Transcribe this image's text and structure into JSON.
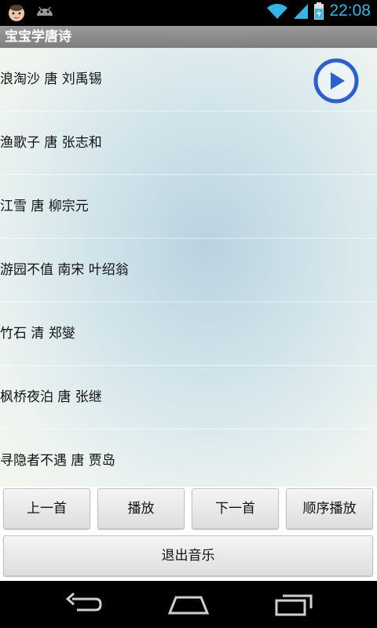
{
  "status_bar": {
    "time": "22:08",
    "icons": [
      "baby-face-icon",
      "android-icon",
      "wifi-icon",
      "signal-icon",
      "battery-icon"
    ],
    "accent_color": "#33b5e5"
  },
  "app": {
    "title": "宝宝学唐诗"
  },
  "poems": [
    {
      "label": "浪淘沙 唐 刘禹锡"
    },
    {
      "label": "渔歌子 唐 张志和"
    },
    {
      "label": "江雪 唐 柳宗元"
    },
    {
      "label": "游园不值 南宋 叶绍翁"
    },
    {
      "label": "竹石 清 郑燮"
    },
    {
      "label": "枫桥夜泊 唐 张继"
    },
    {
      "label": "寻隐者不遇 唐 贾岛"
    }
  ],
  "controls": {
    "prev_label": "上一首",
    "play_label": "播放",
    "next_label": "下一首",
    "order_label": "顺序播放",
    "exit_label": "退出音乐"
  },
  "nav_bar": {
    "icons": [
      "back-icon",
      "home-icon",
      "recent-apps-icon"
    ]
  },
  "colors": {
    "play_icon": "#2c5fd0",
    "titlebar": "#8c8c8c"
  }
}
